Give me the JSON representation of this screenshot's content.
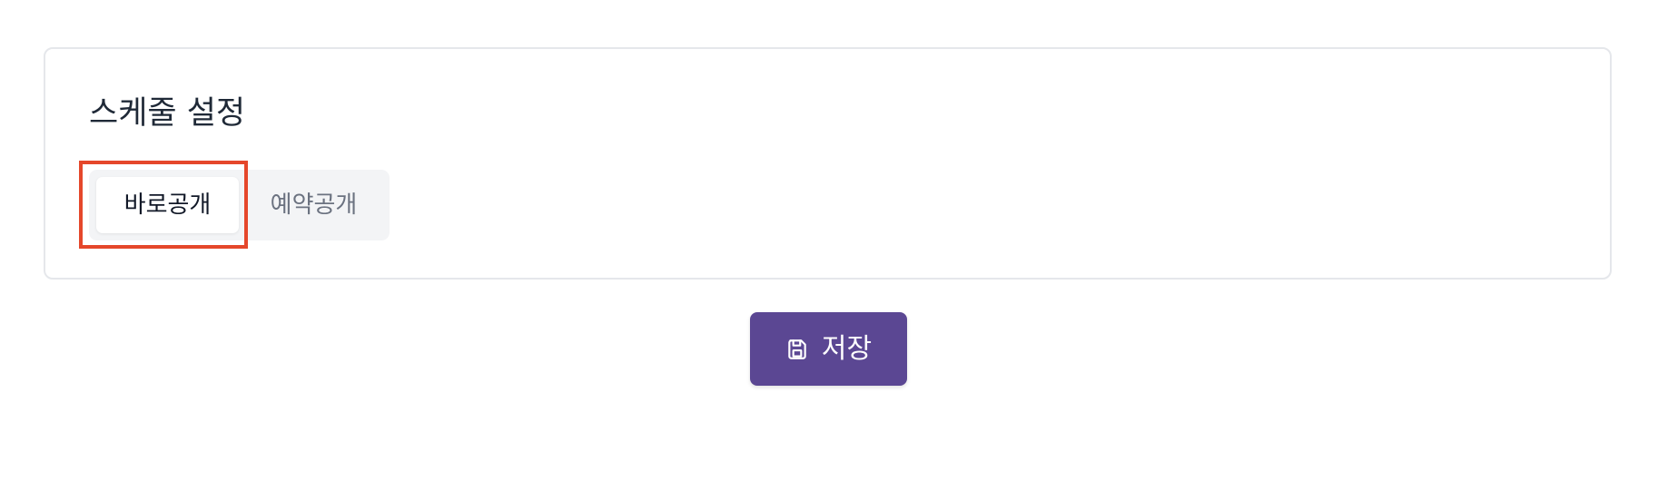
{
  "schedule": {
    "title": "스케줄 설정",
    "options": [
      {
        "label": "바로공개",
        "selected": true
      },
      {
        "label": "예약공개",
        "selected": false
      }
    ]
  },
  "actions": {
    "save_label": "저장",
    "save_icon": "save-icon"
  },
  "colors": {
    "accent": "#5b4793",
    "highlight": "#e5472b",
    "border": "#e5e7eb",
    "segment_bg": "#f3f4f6"
  }
}
